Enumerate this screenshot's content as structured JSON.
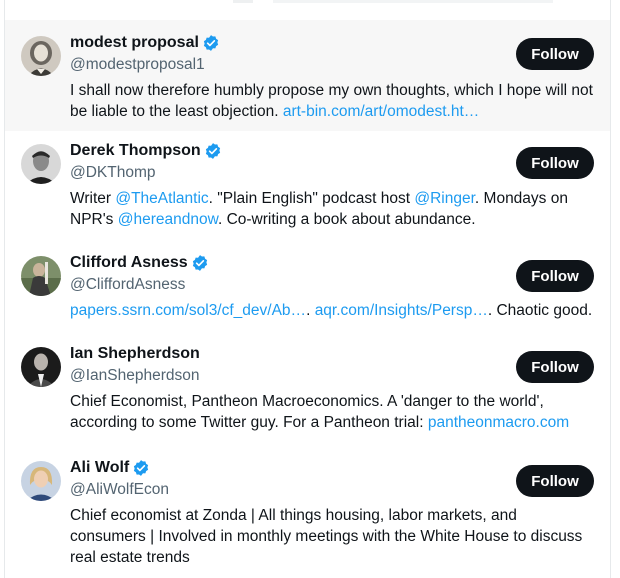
{
  "follow_label": "Follow",
  "accounts": [
    {
      "name": "modest proposal",
      "handle": "@modestproposal1",
      "verified": true,
      "bio": [
        {
          "t": "I shall now therefore humbly propose my own thoughts, which I hope will not be liable to the least objection. ",
          "link": false
        },
        {
          "t": "art-bin.com/art/omodest.ht…",
          "link": true
        }
      ]
    },
    {
      "name": "Derek Thompson",
      "handle": "@DKThomp",
      "verified": true,
      "bio": [
        {
          "t": "Writer ",
          "link": false
        },
        {
          "t": "@TheAtlantic",
          "link": true
        },
        {
          "t": ". \"Plain English\" podcast host ",
          "link": false
        },
        {
          "t": "@Ringer",
          "link": true
        },
        {
          "t": ". Mondays on NPR's ",
          "link": false
        },
        {
          "t": "@hereandnow",
          "link": true
        },
        {
          "t": ". Co-writing a book about abundance.",
          "link": false
        }
      ]
    },
    {
      "name": "Clifford Asness",
      "handle": "@CliffordAsness",
      "verified": true,
      "bio": [
        {
          "t": "papers.ssrn.com/sol3/cf_dev/Ab…",
          "link": true
        },
        {
          "t": ". ",
          "link": false
        },
        {
          "t": "aqr.com/Insights/Persp…",
          "link": true
        },
        {
          "t": ". Chaotic good.",
          "link": false
        }
      ]
    },
    {
      "name": "Ian Shepherdson",
      "handle": "@IanShepherdson",
      "verified": false,
      "bio": [
        {
          "t": "Chief Economist, Pantheon Macroeconomics. A 'danger to the world', according to some Twitter guy. For a Pantheon trial: ",
          "link": false
        },
        {
          "t": "pantheonmacro.com",
          "link": true
        }
      ]
    },
    {
      "name": "Ali Wolf",
      "handle": "@AliWolfEcon",
      "verified": true,
      "bio": [
        {
          "t": "Chief economist at Zonda | All things housing, labor markets, and consumers | Involved in monthly meetings with the White House to discuss real estate trends",
          "link": false
        }
      ]
    }
  ],
  "colors": {
    "link": "#1d9bf0",
    "verified": "#1d9bf0",
    "button_bg": "#0f1419",
    "highlight_bg": "#f7f7f7",
    "handle": "#536471"
  },
  "icons": {
    "verified": "verified-badge-icon",
    "avatar": "avatar-image"
  }
}
